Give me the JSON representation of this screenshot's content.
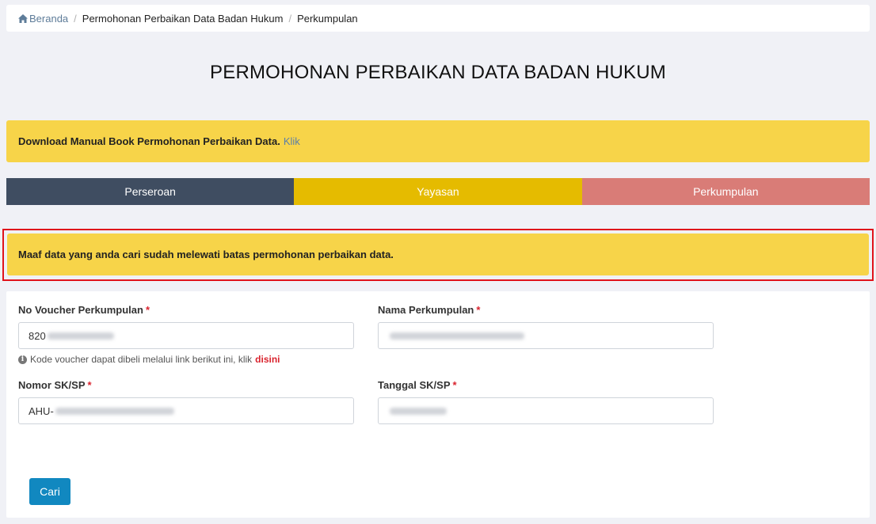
{
  "breadcrumb": {
    "home": "Beranda",
    "items": [
      "Permohonan Perbaikan Data Badan Hukum",
      "Perkumpulan"
    ]
  },
  "title": "PERMOHONAN PERBAIKAN DATA BADAN HUKUM",
  "download_alert": {
    "text": "Download Manual Book Permohonan Perbaikan Data.",
    "link": "Klik"
  },
  "tabs": [
    {
      "label": "Perseroan",
      "color": "#3f4d61"
    },
    {
      "label": "Yayasan",
      "color": "#e5bb00"
    },
    {
      "label": "Perkumpulan",
      "color": "#d97c77"
    }
  ],
  "error_alert": {
    "text": "Maaf data yang anda cari sudah melewati batas permohonan perbaikan data."
  },
  "form": {
    "voucher": {
      "label": "No Voucher Perkumpulan",
      "value": "820",
      "help": "Kode voucher dapat dibeli melalui link berikut ini, klik",
      "help_link": "disini"
    },
    "nama": {
      "label": "Nama Perkumpulan",
      "value": ""
    },
    "nomor_sk": {
      "label": "Nomor SK/SP",
      "value": "AHU-"
    },
    "tanggal_sk": {
      "label": "Tanggal SK/SP",
      "value": ""
    },
    "required_mark": "*",
    "submit_label": "Cari"
  },
  "colors": {
    "alert": "#f7d449",
    "highlight": "#e0131b",
    "button": "#1188c0",
    "required": "#d9232e"
  }
}
